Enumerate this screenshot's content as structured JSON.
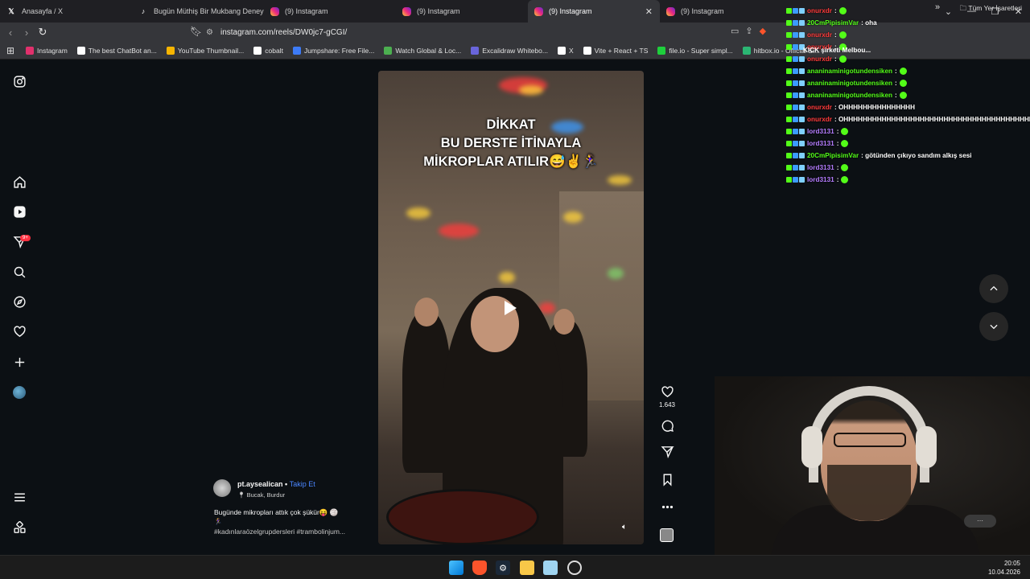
{
  "tabs": [
    {
      "title": "Anasayfa / X",
      "favicon": "x-logo"
    },
    {
      "title": "Bugün Müthiş Bir Mukbang Deneyim",
      "favicon": "tiktok-logo"
    },
    {
      "title": "(9) Instagram",
      "favicon": "instagram-logo"
    },
    {
      "title": "(9) Instagram",
      "favicon": "instagram-logo"
    },
    {
      "title": "(9) Instagram",
      "favicon": "instagram-logo",
      "active": true,
      "close": "✕"
    },
    {
      "title": "(9) Instagram",
      "favicon": "instagram-logo"
    }
  ],
  "address": {
    "url": "instagram.com/reels/DW0jc7-gCGI/"
  },
  "bookmarks": [
    {
      "label": "Instagram",
      "color": "#e1306c"
    },
    {
      "label": "The best ChatBot an...",
      "color": "#ffffff"
    },
    {
      "label": "YouTube Thumbnail...",
      "color": "#f7b500"
    },
    {
      "label": "cobalt",
      "color": "#ffffff"
    },
    {
      "label": "Jumpshare: Free File...",
      "color": "#3d7bf7"
    },
    {
      "label": "Watch Global & Loc...",
      "color": "#4caf50"
    },
    {
      "label": "Excalidraw Whitebo...",
      "color": "#6965db"
    },
    {
      "label": "X",
      "color": "#ffffff"
    },
    {
      "label": "Vite + React + TS",
      "color": "#ffffff"
    },
    {
      "label": "file.io - Super simpl...",
      "color": "#1ecf3c"
    },
    {
      "label": "hitbox.io - Official Si...",
      "color": "#2bb673"
    }
  ],
  "bookmarks_all": "Tüm Yer İşaretleri",
  "sidebar": {
    "notification_badge": "9+"
  },
  "reel": {
    "overlay_lines": [
      "DİKKAT",
      "BU DERSTE İTİNAYLA",
      "MİKROPLAR ATILIR😅✌️🏃‍♀️"
    ],
    "likes": "1.643"
  },
  "caption": {
    "username": "pt.aysealican",
    "separator": " • ",
    "follow": "Takip Et",
    "location": "Bucak, Burdur",
    "text": "Bugünde mikropları attık çok şükür😝 🏐",
    "emoji_line": "🏃‍♀️",
    "hashtags": "#kadınlaraözelgrupdersleri #trambolinjum..."
  },
  "chat": [
    {
      "user": "onurxdr",
      "user_color": "#ff3b3b",
      "message": ":",
      "emote": true
    },
    {
      "user": "20CmPipisimVar",
      "user_color": "#53fc18",
      "message": ": oha",
      "emote": false
    },
    {
      "user": "onurxdr",
      "user_color": "#ff3b3b",
      "message": ":",
      "emote": true
    },
    {
      "user": "onurxdr",
      "user_color": "#ff3b3b",
      "message": ":",
      "emote": true
    },
    {
      "user": "onurxdr",
      "user_color": "#ff3b3b",
      "message": ":",
      "emote": true
    },
    {
      "user": "ananinaminigotundensiken",
      "user_color": "#53fc18",
      "message": ":",
      "emote": true
    },
    {
      "user": "ananinaminigotundensiken",
      "user_color": "#53fc18",
      "message": ":",
      "emote": true
    },
    {
      "user": "ananinaminigotundensiken",
      "user_color": "#53fc18",
      "message": ":",
      "emote": true
    },
    {
      "user": "onurxdr",
      "user_color": "#ff3b3b",
      "message": ": OHHHHHHHHHHHHHHH",
      "emote": false
    },
    {
      "user": "onurxdr",
      "user_color": "#ff3b3b",
      "message": ": OHHHHHHHHHHHHHHHHHHHHHHHHHHHHHHHHHHHHHHHHHH",
      "emote": false
    },
    {
      "user": "lord3131",
      "user_color": "#b57dff",
      "message": ":",
      "emote": true
    },
    {
      "user": "lord3131",
      "user_color": "#b57dff",
      "message": ":",
      "emote": true
    },
    {
      "user": "20CmPipisimVar",
      "user_color": "#53fc18",
      "message": ": götünden çıkıyo sandım alkış sesi",
      "emote": false
    },
    {
      "user": "lord3131",
      "user_color": "#b57dff",
      "message": ":",
      "emote": true
    },
    {
      "user": "lord3131",
      "user_color": "#b57dff",
      "message": ":",
      "emote": true
    }
  ],
  "kick_overlay": "KICK şirketi Melbou...",
  "clock": {
    "time": "20:05",
    "date": "10.04.2026"
  }
}
